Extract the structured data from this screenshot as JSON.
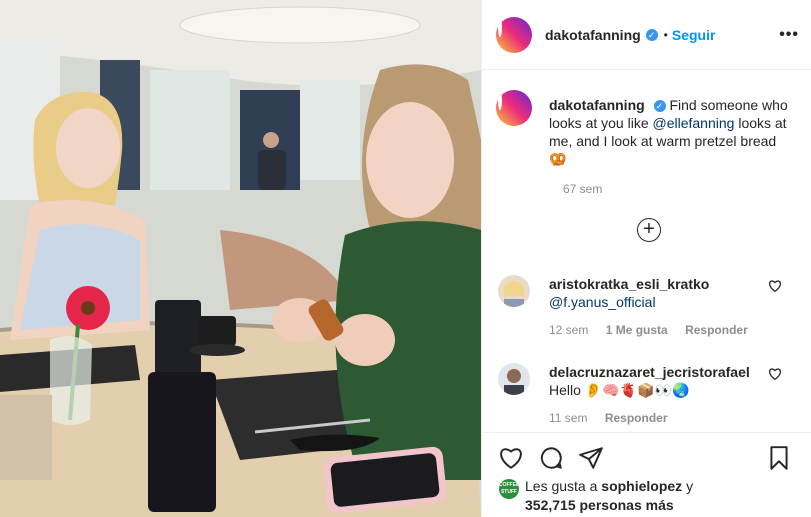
{
  "post": {
    "username": "dakotafanning",
    "verified_badge": "✓",
    "dot": "•",
    "follow_label": "Seguir",
    "more_icon": "more-options-icon",
    "caption": {
      "username": "dakotafanning",
      "text_before": "Find someone who looks at you like ",
      "mention": "@ellefanning",
      "text_after": " looks at me, and I look at warm pretzel bread",
      "emoji": "🥨",
      "time": "67 sem"
    },
    "load_more_icon": "plus-circle-icon",
    "comments": [
      {
        "username": "aristokratka_esli_kratko",
        "text": "@f.yanus_official",
        "time": "12 sem",
        "likes": "1 Me gusta",
        "reply": "Responder"
      },
      {
        "username": "delacruznazaret_jecristorafael",
        "text": "Hello 👂🧠🫀📦👀🌏",
        "time": "11 sem",
        "reply": "Responder"
      }
    ],
    "likes": {
      "avatar_text": "COFFEE STUFF",
      "prefix": "Les gusta a ",
      "user": "sophielopez",
      "suffix": " y",
      "count_line": "352,715 personas más"
    }
  },
  "colors": {
    "link": "#0095f6",
    "mention": "#00376b",
    "meta": "#8e8e8e",
    "border": "#efefef"
  }
}
